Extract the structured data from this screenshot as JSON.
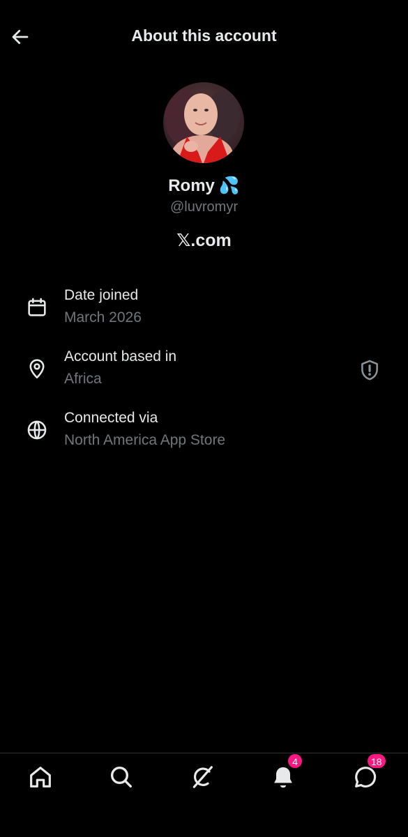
{
  "header": {
    "title": "About this account",
    "back_icon": "arrow-left-icon"
  },
  "profile": {
    "display_name": "Romy",
    "name_emoji": "💦",
    "handle": "@luvromyr",
    "site": "𝕏.com"
  },
  "details": [
    {
      "icon": "calendar-icon",
      "label": "Date joined",
      "value": "March 2026"
    },
    {
      "icon": "location-pin-icon",
      "label": "Account based in",
      "value": "Africa",
      "trailing_icon": "shield-alert-icon"
    },
    {
      "icon": "globe-icon",
      "label": "Connected via",
      "value": "North America App Store"
    }
  ],
  "nav": {
    "items": [
      {
        "icon": "home-icon"
      },
      {
        "icon": "search-icon"
      },
      {
        "icon": "grok-icon"
      },
      {
        "icon": "bell-icon",
        "badge": "4"
      },
      {
        "icon": "messages-icon",
        "badge": "18"
      }
    ]
  },
  "colors": {
    "background": "#000000",
    "primary_text": "#e7e9ea",
    "secondary_text": "#71767b",
    "badge": "#f91880",
    "divider": "#2f3336"
  }
}
